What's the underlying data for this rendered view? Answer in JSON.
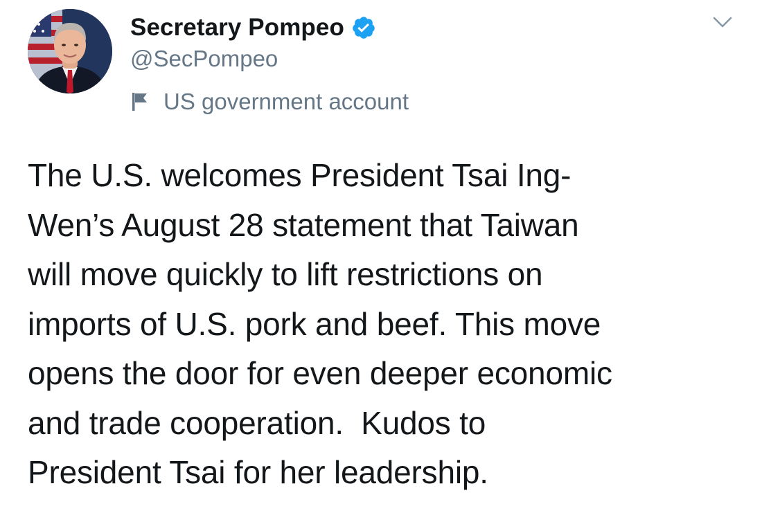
{
  "tweet": {
    "author": {
      "display_name": "Secretary Pompeo",
      "handle": "@SecPompeo",
      "verified": true,
      "label": "US government account"
    },
    "text": "The U.S. welcomes President Tsai Ing-\nWen’s August 28 statement that Taiwan\nwill move quickly to lift restrictions on\nimports of U.S. pork and beef. This move\nopens the door for even deeper economic\nand trade cooperation.  Kudos to\nPresident Tsai for her leadership."
  },
  "icons": {
    "verified": "verified-badge-icon",
    "label_flag": "flag-icon",
    "menu": "chevron-down-icon"
  },
  "colors": {
    "text": "#14171a",
    "secondary": "#657786",
    "verified": "#1da1f2"
  }
}
